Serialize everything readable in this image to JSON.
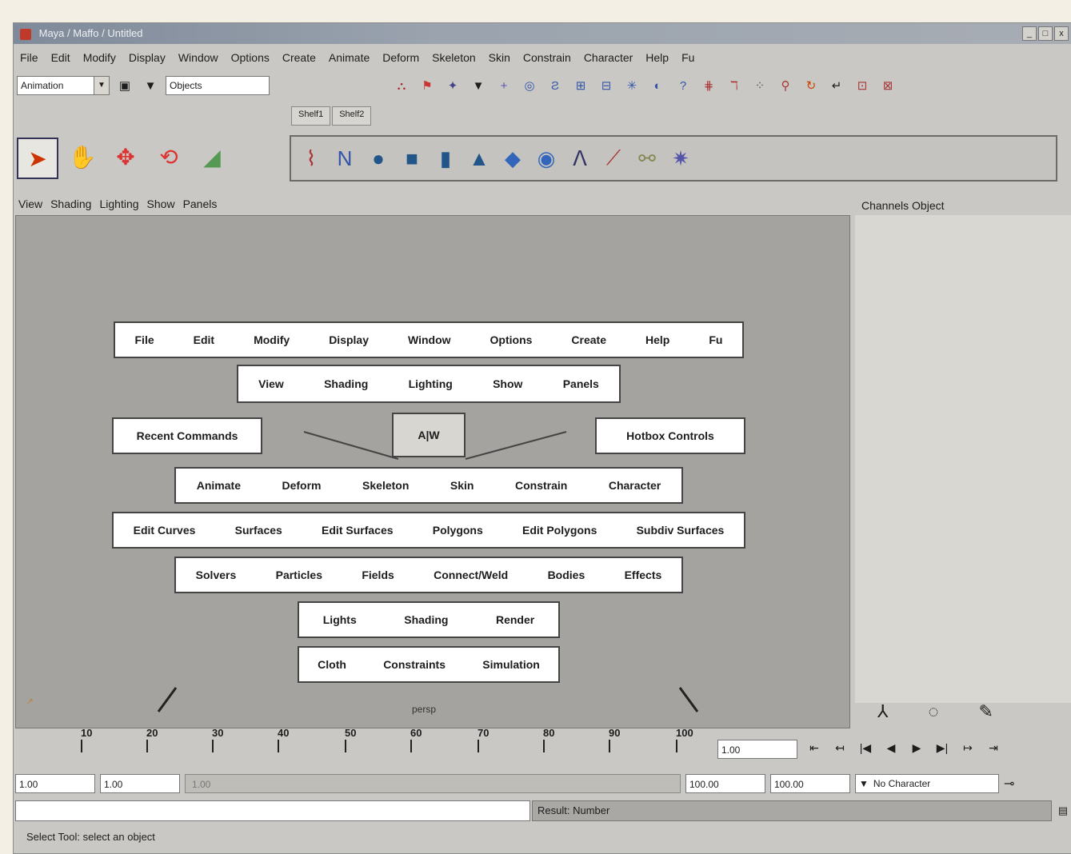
{
  "window": {
    "title": "Maya / Maffo / Untitled",
    "controls": [
      "_",
      "□",
      "x"
    ]
  },
  "menubar": {
    "items": [
      "File",
      "Edit",
      "Modify",
      "Display",
      "Window",
      "Options",
      "Create",
      "Animate",
      "Deform",
      "Skeleton",
      "Skin",
      "Constrain",
      "Character",
      "Help",
      "Fu"
    ]
  },
  "statusline": {
    "menu_set": "Animation",
    "select_mode": "Objects"
  },
  "shelf": {
    "tabs": [
      "Shelf1",
      "Shelf2"
    ]
  },
  "panel": {
    "menus": [
      "View",
      "Shading",
      "Lighting",
      "Show",
      "Panels"
    ],
    "channels_label": "Channels Object",
    "view_label": "persp"
  },
  "hotbox": {
    "main_menu": [
      "File",
      "Edit",
      "Modify",
      "Display",
      "Window",
      "Options",
      "Create",
      "Help",
      "Fu"
    ],
    "panel_menu": [
      "View",
      "Shading",
      "Lighting",
      "Show",
      "Panels"
    ],
    "recent": "Recent Commands",
    "hotbox_controls": "Hotbox Controls",
    "center": "A|W",
    "row_animation": [
      "Animate",
      "Deform",
      "Skeleton",
      "Skin",
      "Constrain",
      "Character"
    ],
    "row_modeling": [
      "Edit Curves",
      "Surfaces",
      "Edit Surfaces",
      "Polygons",
      "Edit Polygons",
      "Subdiv Surfaces"
    ],
    "row_dynamics": [
      "Solvers",
      "Particles",
      "Fields",
      "Connect/Weld",
      "Bodies",
      "Effects"
    ],
    "row_rendering": [
      "Lights",
      "Shading",
      "Render"
    ],
    "row_cloth": [
      "Cloth",
      "Constraints",
      "Simulation"
    ]
  },
  "timeline": {
    "ticks": [
      "10",
      "20",
      "30",
      "40",
      "50",
      "60",
      "70",
      "80",
      "90",
      "100"
    ],
    "current_frame": "1.00"
  },
  "range": {
    "start": "1.00",
    "playback_start": "1.00",
    "playback_end": "1.00",
    "end_a": "100.00",
    "end_b": "100.00",
    "character": "No Character"
  },
  "command": {
    "result": "Result: Number"
  },
  "helpline": {
    "text": "Select Tool: select an object"
  },
  "icons": {
    "shelf": [
      "cv-curve-icon",
      "ep-curve-icon",
      "sphere-icon",
      "cube-icon",
      "cylinder-icon",
      "cone-icon",
      "plane-icon",
      "torus-icon",
      "joint-icon",
      "ik-handle-icon",
      "ik-spline-icon",
      "particle-icon"
    ],
    "tools": [
      "select-icon",
      "lasso-icon",
      "move-icon",
      "rotate-icon",
      "scale-icon"
    ]
  }
}
